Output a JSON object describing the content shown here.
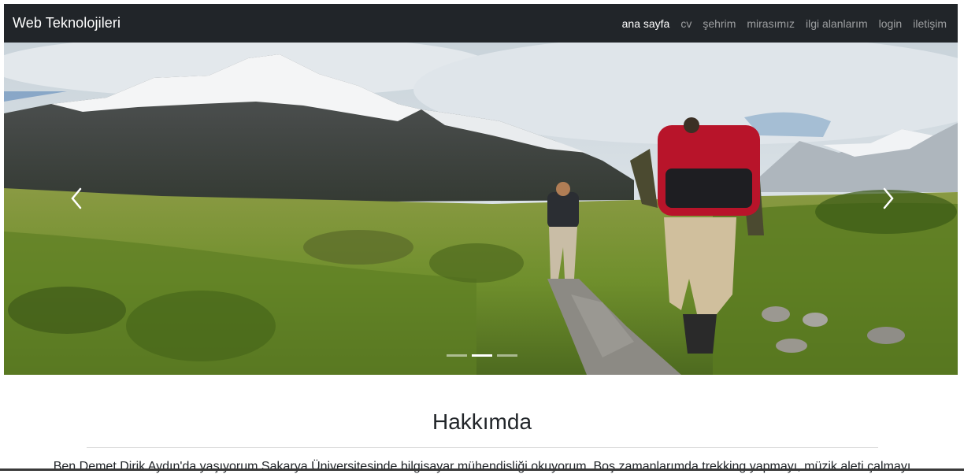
{
  "navbar": {
    "brand": "Web Teknolojileri",
    "links": [
      "ana sayfa",
      "cv",
      "şehrim",
      "mirasımız",
      "ilgi alanlarım",
      "login",
      "iletişim"
    ],
    "active_index": 0,
    "background": "#212529"
  },
  "carousel": {
    "image": "hikers-mountain-trail-photo",
    "prev_icon": "chevron-left-icon",
    "next_icon": "chevron-right-icon",
    "indicator_count": 3,
    "active_indicator": 1
  },
  "about": {
    "title": "Hakkımda",
    "text": "Ben Demet Dirik Aydın'da yaşıyorum Sakarya Üniversitesinde bilgisayar mühendisliği okuyorum. Boş zamanlarımda trekking yapmayı, müzik aleti çalmayı"
  }
}
